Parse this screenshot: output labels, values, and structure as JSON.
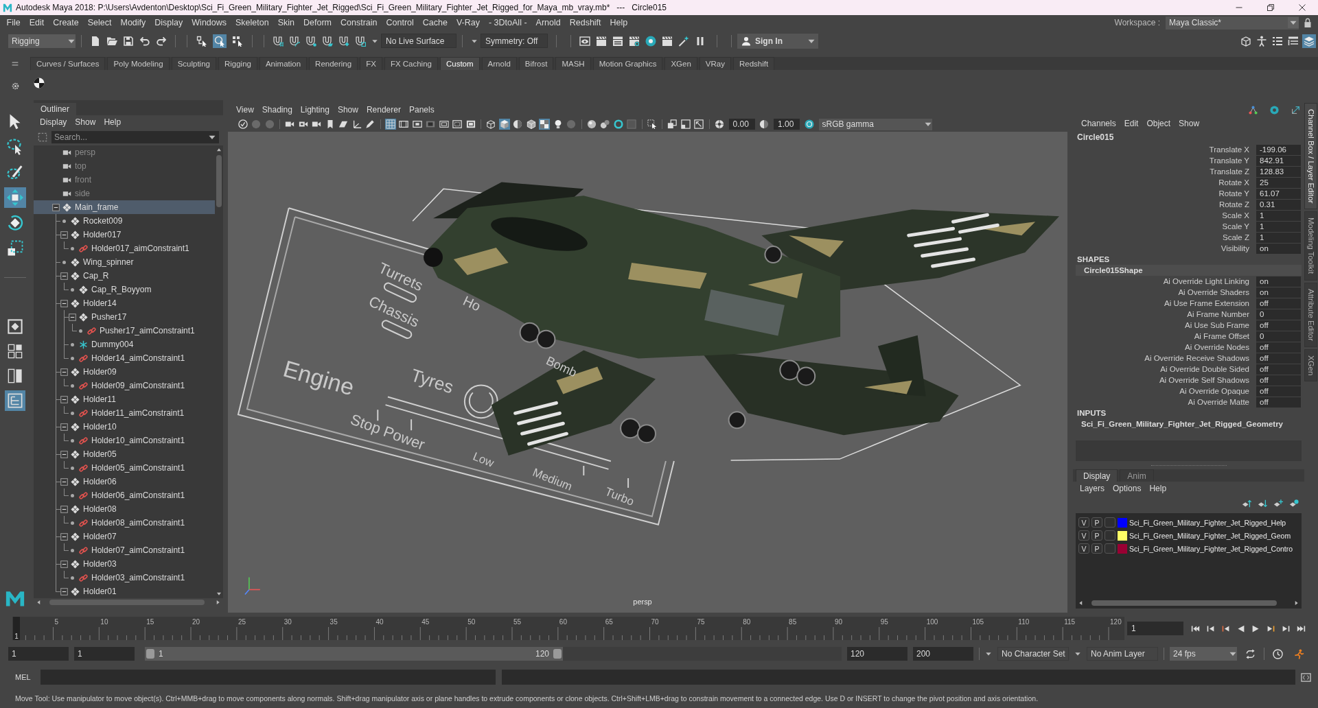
{
  "window": {
    "title": "Autodesk Maya 2018: P:\\Users\\Avdenton\\Desktop\\Sci_Fi_Green_Military_Fighter_Jet_Rigged\\Sci_Fi_Green_Military_Fighter_Jet_Rigged_for_Maya_mb_vray.mb*   ---   Circle015"
  },
  "menu_bar": {
    "items": [
      "File",
      "Edit",
      "Create",
      "Select",
      "Modify",
      "Display",
      "Windows",
      "Skeleton",
      "Skin",
      "Deform",
      "Constrain",
      "Control",
      "Cache",
      "V-Ray",
      "- 3DtoAll -",
      "Arnold",
      "Redshift",
      "Help"
    ],
    "workspace_label": "Workspace :",
    "workspace": "Maya Classic*"
  },
  "status_line": {
    "menu_set": "Rigging",
    "selection_modes": [
      {
        "kind": "hierarchy",
        "selected": false
      },
      {
        "kind": "object",
        "selected": true
      },
      {
        "kind": "component",
        "selected": false
      }
    ],
    "live_surface": "No Live Surface",
    "symmetry": "Symmetry: Off",
    "sign_in": "Sign In",
    "panel_toggles": [
      {
        "kind": "modeling_toolkit",
        "on": false
      },
      {
        "kind": "character_controls",
        "on": false
      },
      {
        "kind": "attribute_editor",
        "on": false
      },
      {
        "kind": "tool_settings",
        "on": false
      },
      {
        "kind": "channel_box",
        "on": true
      }
    ]
  },
  "shelf": {
    "tabs": [
      {
        "label": "Curves / Surfaces",
        "selected": false
      },
      {
        "label": "Poly Modeling",
        "selected": false
      },
      {
        "label": "Sculpting",
        "selected": false
      },
      {
        "label": "Rigging",
        "selected": false
      },
      {
        "label": "Animation",
        "selected": false
      },
      {
        "label": "Rendering",
        "selected": false
      },
      {
        "label": "FX",
        "selected": false
      },
      {
        "label": "FX Caching",
        "selected": false
      },
      {
        "label": "Custom",
        "selected": true
      },
      {
        "label": "Arnold",
        "selected": false
      },
      {
        "label": "Bifrost",
        "selected": false
      },
      {
        "label": "MASH",
        "selected": false
      },
      {
        "label": "Motion Graphics",
        "selected": false
      },
      {
        "label": "XGen",
        "selected": false
      },
      {
        "label": "VRay",
        "selected": false
      },
      {
        "label": "Redshift",
        "selected": false
      }
    ]
  },
  "toolbox": {
    "tools": [
      {
        "kind": "select",
        "selected": false
      },
      {
        "kind": "lasso",
        "selected": false
      },
      {
        "kind": "paint",
        "selected": false
      },
      {
        "kind": "move",
        "selected": true
      },
      {
        "kind": "rotate",
        "selected": false
      },
      {
        "kind": "scale",
        "selected": false
      }
    ],
    "layouts": [
      {
        "kind": "single",
        "selected": false
      },
      {
        "kind": "four",
        "selected": false
      },
      {
        "kind": "two",
        "selected": false
      },
      {
        "kind": "outliner",
        "selected": true
      }
    ]
  },
  "outliner": {
    "title": "Outliner",
    "menus": [
      "Display",
      "Show",
      "Help"
    ],
    "search": {
      "placeholder": "Search..."
    },
    "tree": [
      {
        "name": "persp",
        "kind": "camera",
        "selected": false
      },
      {
        "name": "top",
        "kind": "camera",
        "selected": false
      },
      {
        "name": "front",
        "kind": "camera",
        "selected": false
      },
      {
        "name": "side",
        "kind": "camera",
        "selected": false
      },
      {
        "name": "Main_frame",
        "kind": "transform",
        "selected": true,
        "expanded": true,
        "children": [
          {
            "name": "Rocket009",
            "kind": "transform",
            "selected": false
          },
          {
            "name": "Holder017",
            "kind": "transform",
            "selected": false,
            "expanded": true,
            "children": [
              {
                "name": "Holder017_aimConstraint1",
                "kind": "constraint",
                "selected": false
              }
            ]
          },
          {
            "name": "Wing_spinner",
            "kind": "transform",
            "selected": false
          },
          {
            "name": "Cap_R",
            "kind": "transform",
            "selected": false,
            "expanded": true,
            "children": [
              {
                "name": "Cap_R_Boyyom",
                "kind": "transform",
                "selected": false
              }
            ]
          },
          {
            "name": "Holder14",
            "kind": "transform",
            "selected": false,
            "expanded": true,
            "children": [
              {
                "name": "Pusher17",
                "kind": "transform",
                "selected": false,
                "expanded": true,
                "children": [
                  {
                    "name": "Pusher17_aimConstraint1",
                    "kind": "constraint",
                    "selected": false
                  }
                ]
              },
              {
                "name": "Dummy004",
                "kind": "locator",
                "selected": false
              },
              {
                "name": "Holder14_aimConstraint1",
                "kind": "constraint",
                "selected": false
              }
            ]
          },
          {
            "name": "Holder09",
            "kind": "transform",
            "selected": false,
            "expanded": true,
            "children": [
              {
                "name": "Holder09_aimConstraint1",
                "kind": "constraint",
                "selected": false
              }
            ]
          },
          {
            "name": "Holder11",
            "kind": "transform",
            "selected": false,
            "expanded": true,
            "children": [
              {
                "name": "Holder11_aimConstraint1",
                "kind": "constraint",
                "selected": false
              }
            ]
          },
          {
            "name": "Holder10",
            "kind": "transform",
            "selected": false,
            "expanded": true,
            "children": [
              {
                "name": "Holder10_aimConstraint1",
                "kind": "constraint",
                "selected": false
              }
            ]
          },
          {
            "name": "Holder05",
            "kind": "transform",
            "selected": false,
            "expanded": true,
            "children": [
              {
                "name": "Holder05_aimConstraint1",
                "kind": "constraint",
                "selected": false
              }
            ]
          },
          {
            "name": "Holder06",
            "kind": "transform",
            "selected": false,
            "expanded": true,
            "children": [
              {
                "name": "Holder06_aimConstraint1",
                "kind": "constraint",
                "selected": false
              }
            ]
          },
          {
            "name": "Holder08",
            "kind": "transform",
            "selected": false,
            "expanded": true,
            "children": [
              {
                "name": "Holder08_aimConstraint1",
                "kind": "constraint",
                "selected": false
              }
            ]
          },
          {
            "name": "Holder07",
            "kind": "transform",
            "selected": false,
            "expanded": true,
            "children": [
              {
                "name": "Holder07_aimConstraint1",
                "kind": "constraint",
                "selected": false
              }
            ]
          },
          {
            "name": "Holder03",
            "kind": "transform",
            "selected": false,
            "expanded": true,
            "children": [
              {
                "name": "Holder03_aimConstraint1",
                "kind": "constraint",
                "selected": false
              }
            ]
          },
          {
            "name": "Holder01",
            "kind": "transform",
            "selected": false,
            "expanded": true
          }
        ]
      }
    ]
  },
  "viewport": {
    "menus": [
      "View",
      "Shading",
      "Lighting",
      "Show",
      "Renderer",
      "Panels"
    ],
    "toolbar_toggles": [
      {
        "kind": "grid",
        "on": true
      },
      {
        "kind": "wireframe",
        "on": false
      },
      {
        "kind": "shaded",
        "on": true
      },
      {
        "kind": "wire_on_shaded",
        "on": false
      },
      {
        "kind": "textured",
        "on": true
      },
      {
        "kind": "lights",
        "on": false
      },
      {
        "kind": "shadows",
        "on": false
      }
    ],
    "exposure": "0.00",
    "gamma": "1.00",
    "color_space": "sRGB gamma",
    "scene_labels": [
      "Turrets",
      "Ho",
      "Chassis",
      "Bomb",
      "Engine",
      "Tyres",
      "Stop Power",
      "Low",
      "Medium",
      "Turbo"
    ],
    "camera": "persp"
  },
  "channel_box": {
    "menus": [
      "Channels",
      "Edit",
      "Object",
      "Show"
    ],
    "object": "Circle015",
    "channels": [
      {
        "name": "Translate X",
        "value": "-199.06"
      },
      {
        "name": "Translate Y",
        "value": "842.91"
      },
      {
        "name": "Translate Z",
        "value": "128.83"
      },
      {
        "name": "Rotate X",
        "value": "25"
      },
      {
        "name": "Rotate Y",
        "value": "61.07"
      },
      {
        "name": "Rotate Z",
        "value": "0.31"
      },
      {
        "name": "Scale X",
        "value": "1"
      },
      {
        "name": "Scale Y",
        "value": "1"
      },
      {
        "name": "Scale Z",
        "value": "1"
      },
      {
        "name": "Visibility",
        "value": "on"
      }
    ],
    "shapes_heading": "SHAPES",
    "shape": "Circle015Shape",
    "shape_channels": [
      {
        "name": "Ai Override Light Linking",
        "value": "on"
      },
      {
        "name": "Ai Override Shaders",
        "value": "on"
      },
      {
        "name": "Ai Use Frame Extension",
        "value": "off"
      },
      {
        "name": "Ai Frame Number",
        "value": "0"
      },
      {
        "name": "Ai Use Sub Frame",
        "value": "off"
      },
      {
        "name": "Ai Frame Offset",
        "value": "0"
      },
      {
        "name": "Ai Override Nodes",
        "value": "off"
      },
      {
        "name": "Ai Override Receive Shadows",
        "value": "off"
      },
      {
        "name": "Ai Override Double Sided",
        "value": "off"
      },
      {
        "name": "Ai Override Self Shadows",
        "value": "off"
      },
      {
        "name": "Ai Override Opaque",
        "value": "off"
      },
      {
        "name": "Ai Override Matte",
        "value": "off"
      }
    ],
    "inputs_heading": "INPUTS",
    "input": "Sci_Fi_Green_Military_Fighter_Jet_Rigged_Geometry"
  },
  "layer_editor": {
    "tabs": [
      {
        "label": "Display",
        "selected": true
      },
      {
        "label": "Anim",
        "selected": false
      }
    ],
    "menus": [
      "Layers",
      "Options",
      "Help"
    ],
    "layers": [
      {
        "visibility_button": "V",
        "playback_button": "P",
        "color": "#0000ff",
        "name": "Sci_Fi_Green_Military_Fighter_Jet_Rigged_Help"
      },
      {
        "visibility_button": "V",
        "playback_button": "P",
        "color": "#ffff66",
        "name": "Sci_Fi_Green_Military_Fighter_Jet_Rigged_Geom"
      },
      {
        "visibility_button": "V",
        "playback_button": "P",
        "color": "#990033",
        "name": "Sci_Fi_Green_Military_Fighter_Jet_Rigged_Contro"
      }
    ]
  },
  "side_tabs": [
    {
      "label": "Channel Box / Layer Editor",
      "selected": true
    },
    {
      "label": "Modeling Toolkit",
      "selected": false
    },
    {
      "label": "Attribute Editor",
      "selected": false
    },
    {
      "label": "XGen",
      "selected": false
    }
  ],
  "timeline": {
    "tick_labels": [
      "5",
      "10",
      "15",
      "20",
      "25",
      "30",
      "35",
      "40",
      "45",
      "50",
      "55",
      "60",
      "65",
      "70",
      "75",
      "80",
      "85",
      "90",
      "95",
      "100",
      "105",
      "110",
      "115",
      "120"
    ],
    "current_frame": "1",
    "level": 0,
    "current_frame_field": "1"
  },
  "range_slider": {
    "start": "1",
    "playback_start": "1",
    "range_start": "1",
    "range_end": "120",
    "level": 0.6,
    "playback_end": "120",
    "end": "200",
    "character_set": "No Character Set",
    "anim_layer": "No Anim Layer",
    "fps": "24 fps"
  },
  "command_line": {
    "language": "MEL"
  },
  "help_line": {
    "text": "Move Tool: Use manipulator to move object(s). Ctrl+MMB+drag to move components along normals. Shift+drag manipulator axis or plane handles to extrude components or clone objects. Ctrl+Shift+LMB+drag to constrain movement to a connected edge. Use D or INSERT to change the pivot position and axis orientation."
  }
}
